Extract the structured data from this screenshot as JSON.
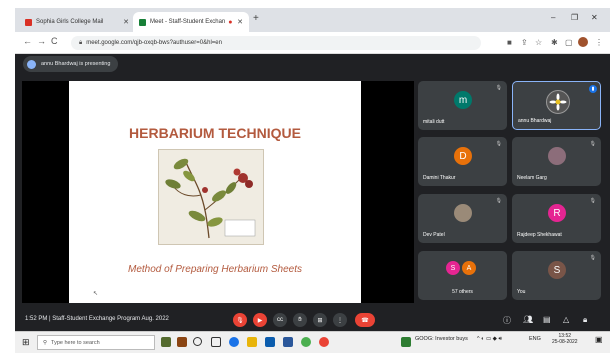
{
  "browser": {
    "tabs": [
      {
        "title": "Sophia Girls College Mail",
        "favicon_color": "#d93025"
      },
      {
        "title": "Meet - Staff-Student Exchan",
        "favicon_color": "#188038"
      }
    ],
    "new_tab": "+",
    "url": "meet.google.com/qjb-oxqb-bws?authuser=0&hl=en"
  },
  "meet": {
    "presenting_banner": "annu Bhardwaj is presenting",
    "slide": {
      "title": "HERBARIUM TECHNIQUE",
      "subtitle": "Method of Preparing Herbarium Sheets"
    },
    "participants": [
      {
        "name": "mitali dutt",
        "initial": "m",
        "color": "#00796b"
      },
      {
        "name": "annu Bhardwaj",
        "initial": "",
        "color": "#555"
      },
      {
        "name": "Damini Thakur",
        "initial": "D",
        "color": "#e8710a"
      },
      {
        "name": "Neelam Garg",
        "initial": "",
        "color": "#777"
      },
      {
        "name": "Dev Patel",
        "initial": "",
        "color": "#888"
      },
      {
        "name": "Rajdeep Shekhawat",
        "initial": "R",
        "color": "#e52592"
      },
      {
        "name": "57 others",
        "initial": "",
        "color": ""
      },
      {
        "name": "You",
        "initial": "S",
        "color": "#795548"
      }
    ],
    "others_initials": [
      "S",
      "A"
    ],
    "meeting_info": "1:52 PM  |  Staff-Student Exchange Program Aug. 2022"
  },
  "taskbar": {
    "search_placeholder": "Type here to search",
    "news": "GOOG: Investor buys",
    "lang": "ENG",
    "time": "13:52",
    "date": "25-08-2022"
  }
}
